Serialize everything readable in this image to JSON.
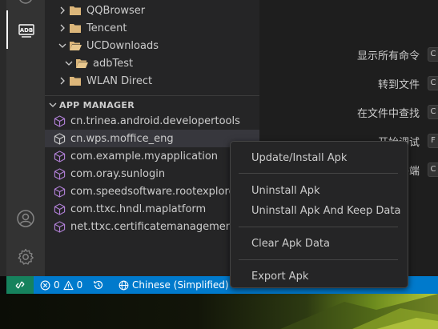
{
  "explorer": {
    "items": [
      {
        "label": "QQBrowser",
        "expanded": false
      },
      {
        "label": "Tencent",
        "expanded": false
      },
      {
        "label": "UCDownloads",
        "expanded": true
      },
      {
        "label": "adbTest",
        "expanded": true
      },
      {
        "label": "WLAN Direct",
        "expanded": false
      }
    ]
  },
  "app_manager": {
    "title": "APP MANAGER",
    "packages": [
      "cn.trinea.android.developertools",
      "cn.wps.moffice_eng",
      "com.example.myapplication",
      "com.oray.sunlogin",
      "com.speedsoftware.rootexplorer",
      "com.ttxc.hndl.maplatform",
      "net.ttxc.certificatemanagement"
    ],
    "selected_index": 1
  },
  "activity_bar": {
    "adb_label": "ADB",
    "icons": [
      "adb-icon",
      "account-icon",
      "gear-icon"
    ]
  },
  "editor_commands": [
    {
      "label": "显示所有命令",
      "key": "C"
    },
    {
      "label": "转到文件",
      "key": "C"
    },
    {
      "label": "在文件中查找",
      "key": "C"
    },
    {
      "label": "开始调试",
      "key": "F"
    },
    {
      "label": "切换终端",
      "key": "C"
    }
  ],
  "context_menu": {
    "groups": [
      [
        "Update/Install Apk"
      ],
      [
        "Uninstall Apk",
        "Uninstall Apk And Keep Data"
      ],
      [
        "Clear Apk Data"
      ],
      [
        "Export Apk"
      ]
    ]
  },
  "status_bar": {
    "errors": "0",
    "warnings": "0",
    "language": "Chinese (Simplified)"
  },
  "colors": {
    "accent": "#007acc",
    "remote": "#16825d",
    "package_icon": "#b180d7",
    "folder": "#dcb67a"
  }
}
